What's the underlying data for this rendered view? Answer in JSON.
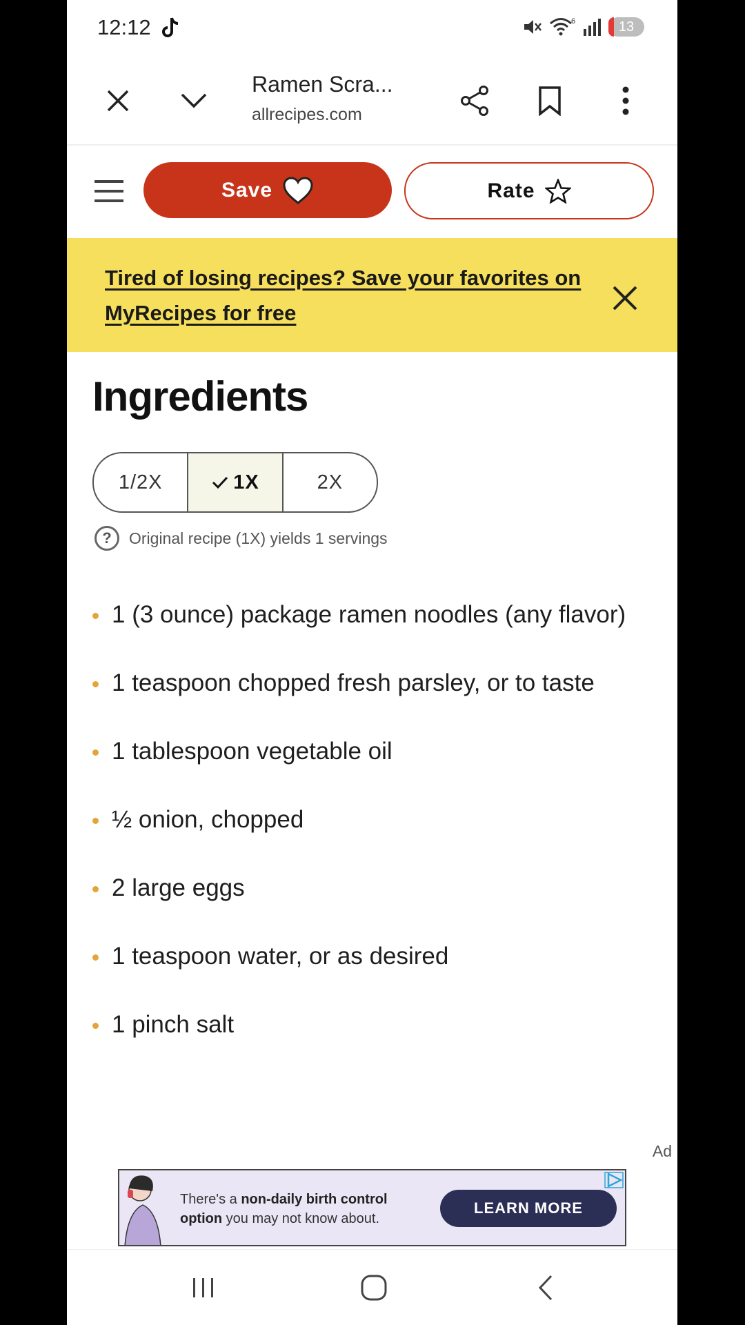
{
  "status_bar": {
    "time": "12:12",
    "network_badge": "6",
    "battery_level": "13",
    "icons": [
      "tiktok-icon",
      "mute-icon",
      "wifi-icon",
      "signal-icon",
      "battery-icon"
    ]
  },
  "browser": {
    "page_title": "Ramen Scra...",
    "url": "allrecipes.com",
    "icons": [
      "close-icon",
      "chevron-down-icon",
      "share-icon",
      "bookmark-icon",
      "more-vert-icon"
    ]
  },
  "site_header": {
    "save_label": "Save",
    "rate_label": "Rate",
    "brand_color": "#c8341a"
  },
  "banner": {
    "text": "Tired of losing recipes? Save your favorites on MyRecipes for free",
    "background": "#f6df5c"
  },
  "ingredients": {
    "heading": "Ingredients",
    "scale_options": [
      {
        "label": "1/2X",
        "selected": false
      },
      {
        "label": "1X",
        "selected": true
      },
      {
        "label": "2X",
        "selected": false
      }
    ],
    "yield_text": "Original recipe (1X) yields 1 servings",
    "items": [
      "1 (3 ounce) package ramen noodles (any flavor)",
      "1 teaspoon chopped fresh parsley, or to taste",
      "1 tablespoon vegetable oil",
      "½ onion, chopped",
      "2 large eggs",
      "1 teaspoon water, or as desired",
      "1 pinch salt"
    ]
  },
  "ad": {
    "label": "Ad",
    "text_pre": "There's a",
    "text_bold1": "non-daily birth control",
    "text_bold2": "option",
    "text_post": "you may not know about.",
    "cta": "LEARN MORE"
  },
  "nav_bar": {
    "icons": [
      "recents-icon",
      "home-icon",
      "back-icon"
    ]
  }
}
